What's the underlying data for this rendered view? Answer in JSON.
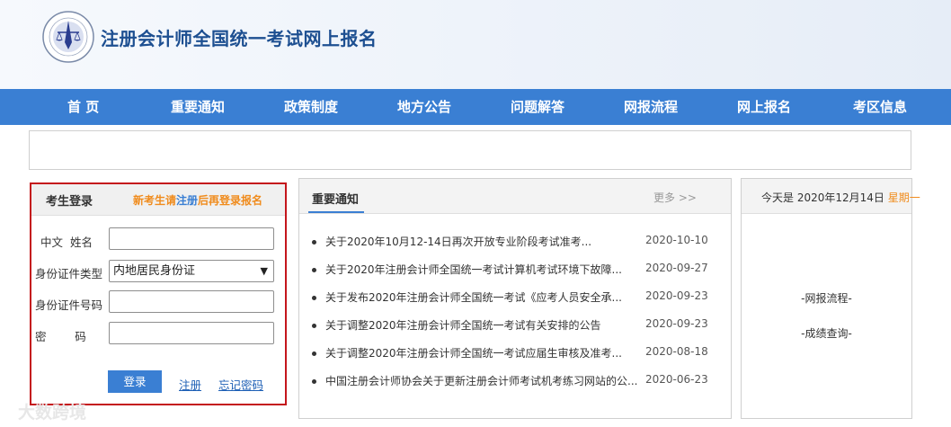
{
  "header": {
    "title": "注册会计师全国统一考试网上报名"
  },
  "nav": [
    {
      "label": "首 页"
    },
    {
      "label": "重要通知"
    },
    {
      "label": "政策制度"
    },
    {
      "label": "地方公告"
    },
    {
      "label": "问题解答"
    },
    {
      "label": "网报流程"
    },
    {
      "label": "网上报名"
    },
    {
      "label": "考区信息"
    }
  ],
  "login": {
    "title": "考生登录",
    "tip_before": "新考生请",
    "tip_link": "注册",
    "tip_after": "后再登录报名",
    "name_label": "中文  姓名",
    "id_type_label": "身份证件类型",
    "id_type_value": "内地居民身份证",
    "id_number_label": "身份证件号码",
    "password_label": "密        码",
    "login_button": "登录",
    "register_link": "注册",
    "forgot_link": "忘记密码"
  },
  "notices": {
    "title": "重要通知",
    "more": "更多 >>",
    "items": [
      {
        "text": "关于2020年10月12-14日再次开放专业阶段考试准考...",
        "date": "2020-10-10"
      },
      {
        "text": "关于2020年注册会计师全国统一考试计算机考试环境下故障...",
        "date": "2020-09-27"
      },
      {
        "text": "关于发布2020年注册会计师全国统一考试《应考人员安全承...",
        "date": "2020-09-23"
      },
      {
        "text": "关于调整2020年注册会计师全国统一考试有关安排的公告",
        "date": "2020-09-23"
      },
      {
        "text": "关于调整2020年注册会计师全国统一考试应届生审核及准考...",
        "date": "2020-08-18"
      },
      {
        "text": "中国注册会计师协会关于更新注册会计师考试机考练习网站的公...",
        "date": "2020-06-23"
      }
    ]
  },
  "side": {
    "date_prefix": "今天是 2020年12月14日",
    "weekday": "星期一",
    "links": [
      {
        "label": "-网报流程-"
      },
      {
        "label": "-成绩查询-"
      }
    ]
  },
  "watermark": "大数跨境",
  "colors": {
    "nav_bg": "#3a7fd3",
    "title": "#1d4f91",
    "highlight": "#f08b1c",
    "login_border": "#c4161c"
  }
}
